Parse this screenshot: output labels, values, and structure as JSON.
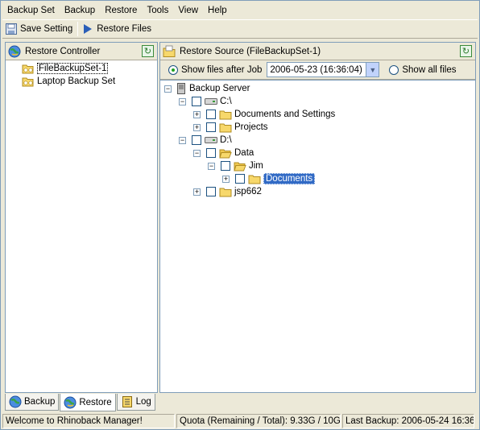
{
  "menu": {
    "items": [
      "Backup Set",
      "Backup",
      "Restore",
      "Tools",
      "View",
      "Help"
    ]
  },
  "toolbar": {
    "save_label": "Save Setting",
    "restore_label": "Restore Files"
  },
  "left_panel": {
    "title": "Restore Controller",
    "items": [
      {
        "label": "FileBackupSet-1",
        "selected": true
      },
      {
        "label": "Laptop Backup Set",
        "selected": false
      }
    ]
  },
  "right_panel": {
    "title": "Restore Source (FileBackupSet-1)",
    "filter": {
      "show_after_job_label": "Show files after Job",
      "job_value": "2006-05-23 (16:36:04)",
      "show_all_label": "Show all files"
    },
    "tree": {
      "root": "Backup Server",
      "c_drive": "C:\\",
      "c_children": [
        "Documents and Settings",
        "Projects"
      ],
      "d_drive": "D:\\",
      "data": "Data",
      "jim": "Jim",
      "documents": "Documents",
      "jsp": "jsp662"
    }
  },
  "tabs": {
    "backup": "Backup",
    "restore": "Restore",
    "log": "Log"
  },
  "status": {
    "welcome": "Welcome to Rhinoback Manager!",
    "quota": "Quota (Remaining / Total): 9.33G / 10G",
    "last_backup": "Last Backup: 2006-05-24 16:36"
  },
  "colors": {
    "accent": "#316ac5",
    "folder": "#f7d86b",
    "chrome": "#ece9d8"
  }
}
